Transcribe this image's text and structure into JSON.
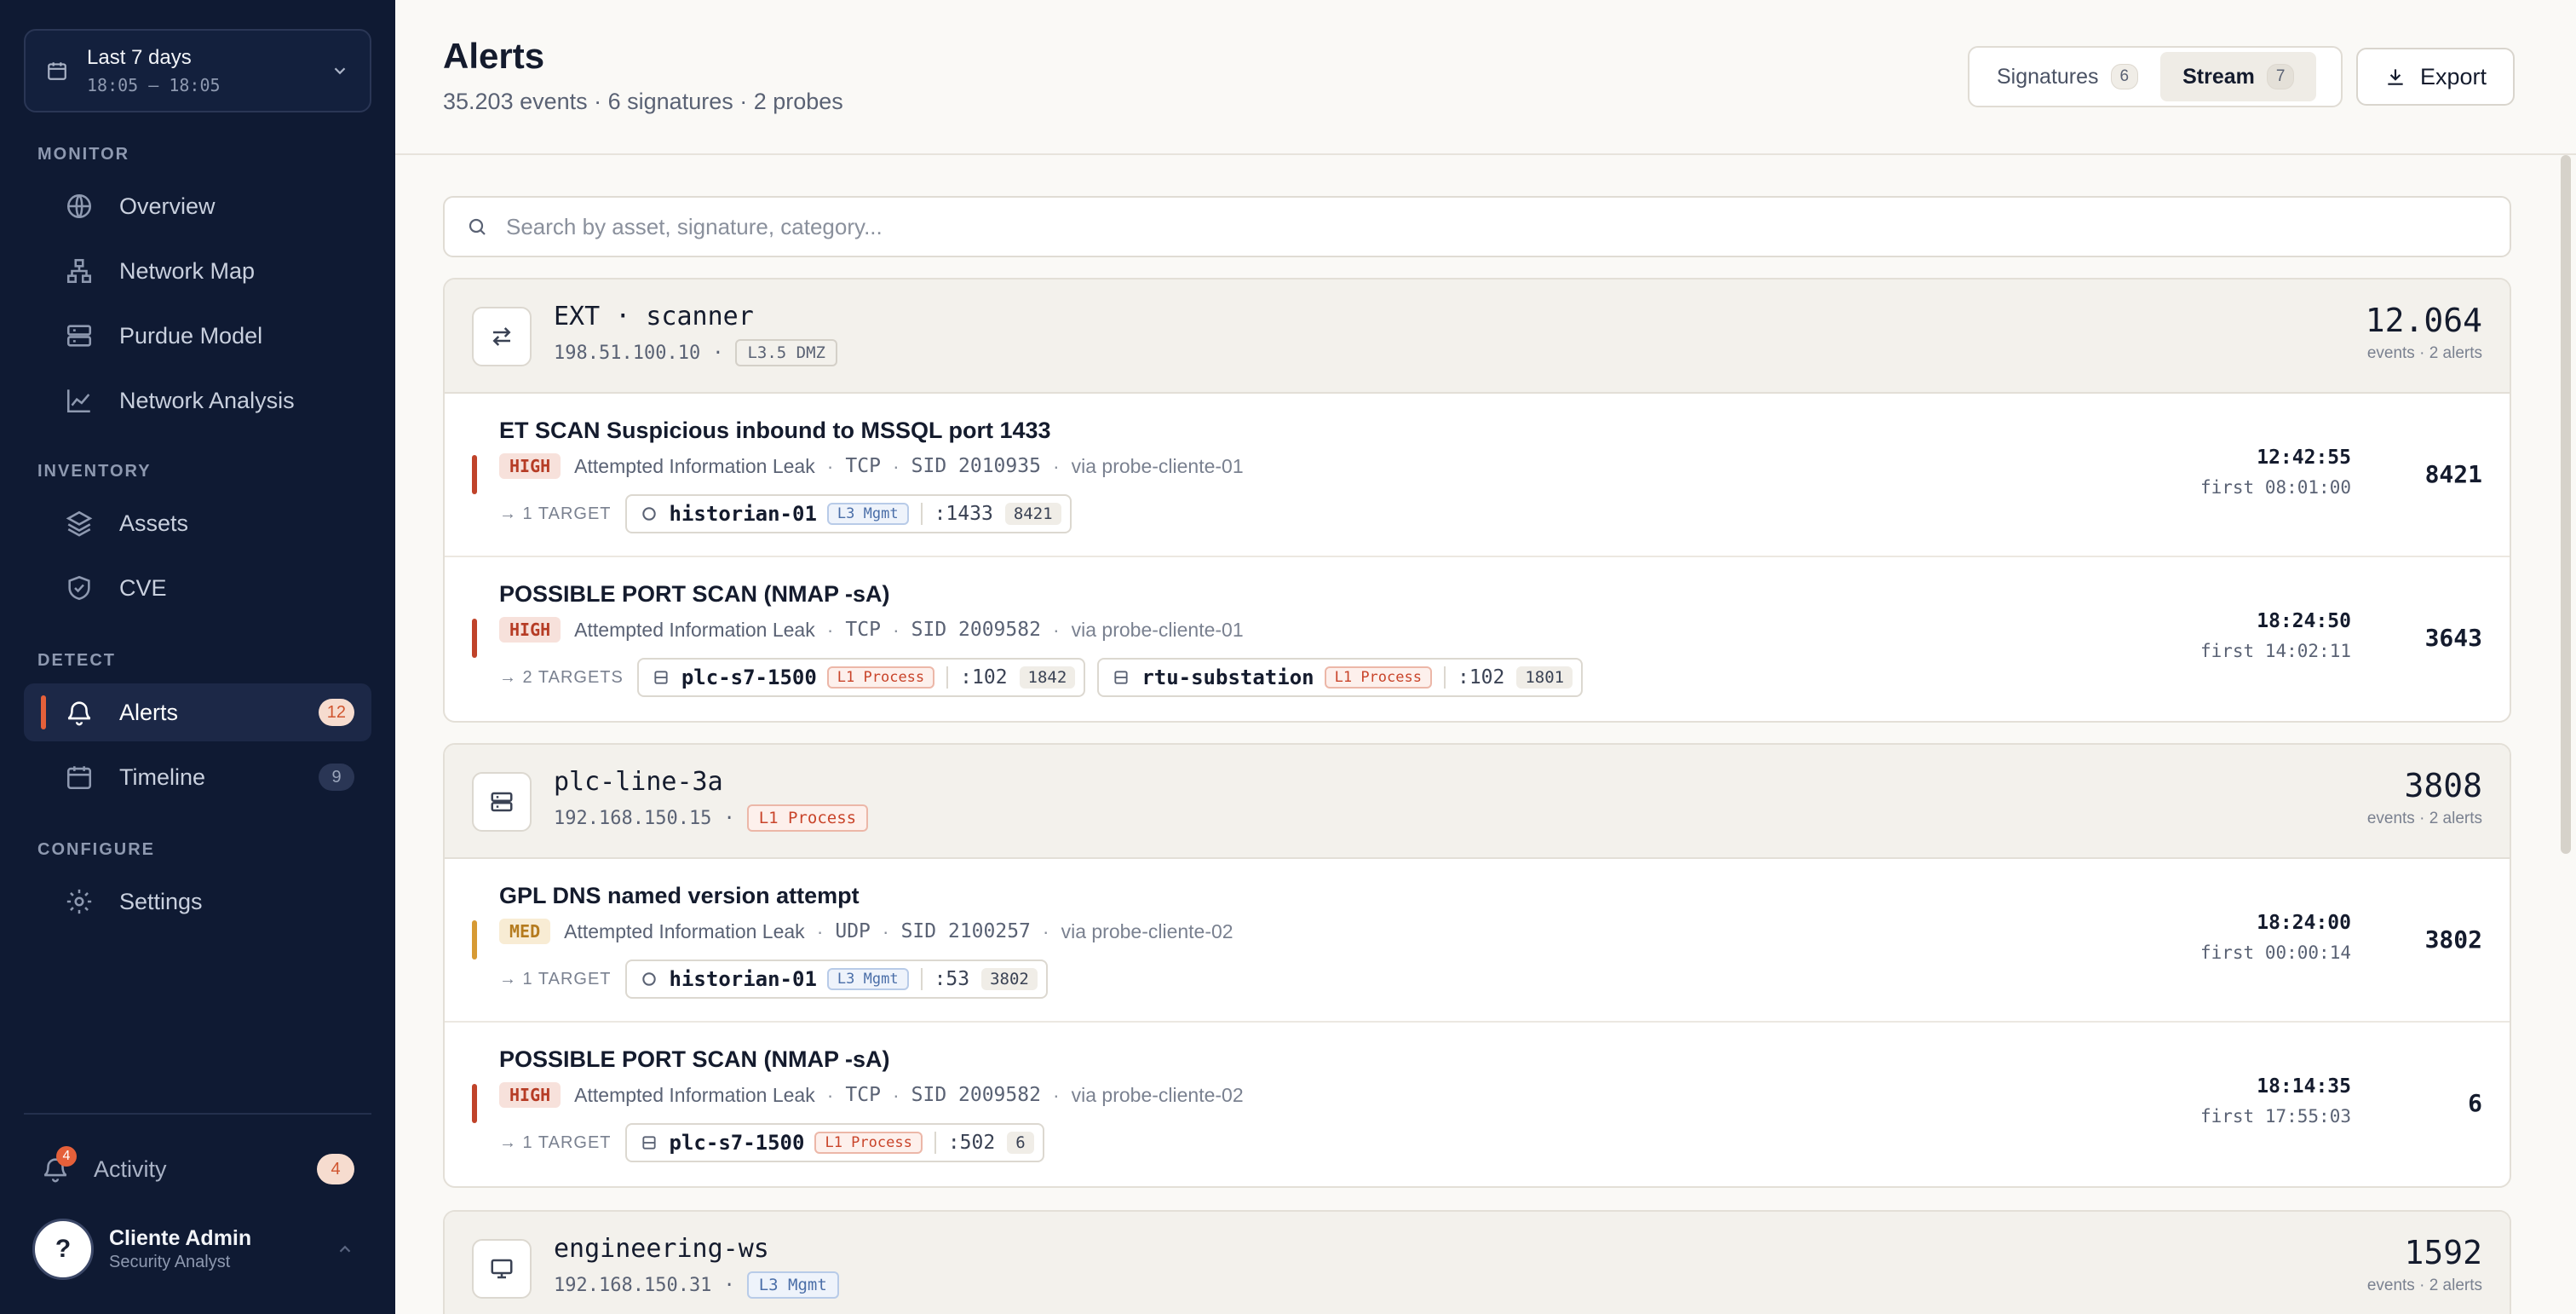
{
  "sidebar": {
    "date_range": {
      "label": "Last 7 days",
      "time": "18:05 – 18:05"
    },
    "sections": {
      "monitor": "MONITOR",
      "inventory": "INVENTORY",
      "detect": "DETECT",
      "configure": "CONFIGURE"
    },
    "items": {
      "overview": "Overview",
      "network_map": "Network Map",
      "purdue_model": "Purdue Model",
      "network_analysis": "Network Analysis",
      "assets": "Assets",
      "cve": "CVE",
      "alerts": "Alerts",
      "alerts_badge": "12",
      "timeline": "Timeline",
      "timeline_badge": "9",
      "settings": "Settings"
    },
    "activity": {
      "label": "Activity",
      "dot": "4",
      "badge": "4"
    },
    "user": {
      "avatar": "?",
      "name": "Cliente Admin",
      "role": "Security Analyst"
    },
    "accent_color": "#e5603a"
  },
  "header": {
    "title": "Alerts",
    "subtitle": "35.203 events · 6 signatures · 2 probes",
    "view_toggle": {
      "signatures_label": "Signatures",
      "signatures_count": "6",
      "stream_label": "Stream",
      "stream_count": "7",
      "selected": "Stream"
    },
    "export_label": "Export"
  },
  "search": {
    "placeholder": "Search by asset, signature, category...",
    "value": ""
  },
  "groups": [
    {
      "name": "EXT · scanner",
      "ip": "198.51.100.10",
      "tag": "L3.5 DMZ",
      "icon": "arrows-swap-icon",
      "total": "12.064",
      "total_sub": "events · 2 alerts",
      "alerts": [
        {
          "title": "ET SCAN Suspicious inbound to MSSQL port 1433",
          "severity": "HIGH",
          "category": "Attempted Information Leak",
          "proto": "TCP",
          "sid": "SID 2010935",
          "probe": "via probe-cliente-01",
          "targets_label": "→ 1 TARGET",
          "targets": [
            {
              "name": "historian-01",
              "tag": "L3 Mgmt",
              "port": ":1433",
              "count": "8421"
            }
          ],
          "last": "12:42:55",
          "first": "first 08:01:00",
          "count": "8421"
        },
        {
          "title": "POSSIBLE PORT SCAN (NMAP -sA)",
          "severity": "HIGH",
          "category": "Attempted Information Leak",
          "proto": "TCP",
          "sid": "SID 2009582",
          "probe": "via probe-cliente-01",
          "targets_label": "→ 2 TARGETS",
          "targets": [
            {
              "name": "plc-s7-1500",
              "tag": "L1 Process",
              "port": ":102",
              "count": "1842"
            },
            {
              "name": "rtu-substation",
              "tag": "L1 Process",
              "port": ":102",
              "count": "1801"
            }
          ],
          "last": "18:24:50",
          "first": "first 14:02:11",
          "count": "3643"
        }
      ]
    },
    {
      "name": "plc-line-3a",
      "ip": "192.168.150.15",
      "tag": "L1 Process",
      "icon": "server-icon",
      "total": "3808",
      "total_sub": "events · 2 alerts",
      "alerts": [
        {
          "title": "GPL DNS named version attempt",
          "severity": "MED",
          "category": "Attempted Information Leak",
          "proto": "UDP",
          "sid": "SID 2100257",
          "probe": "via probe-cliente-02",
          "targets_label": "→ 1 TARGET",
          "targets": [
            {
              "name": "historian-01",
              "tag": "L3 Mgmt",
              "port": ":53",
              "count": "3802"
            }
          ],
          "last": "18:24:00",
          "first": "first 00:00:14",
          "count": "3802"
        },
        {
          "title": "POSSIBLE PORT SCAN (NMAP -sA)",
          "severity": "HIGH",
          "category": "Attempted Information Leak",
          "proto": "TCP",
          "sid": "SID 2009582",
          "probe": "via probe-cliente-02",
          "targets_label": "→ 1 TARGET",
          "targets": [
            {
              "name": "plc-s7-1500",
              "tag": "L1 Process",
              "port": ":502",
              "count": "6"
            }
          ],
          "last": "18:14:35",
          "first": "first 17:55:03",
          "count": "6"
        }
      ]
    },
    {
      "name": "engineering-ws",
      "ip": "192.168.150.31",
      "tag": "L3 Mgmt",
      "icon": "monitor-icon",
      "total": "1592",
      "total_sub": "events · 2 alerts"
    }
  ],
  "colors": {
    "severity_high": "#c0432a",
    "severity_med": "#d79a34",
    "sidebar_bg": "#0f1a33"
  }
}
